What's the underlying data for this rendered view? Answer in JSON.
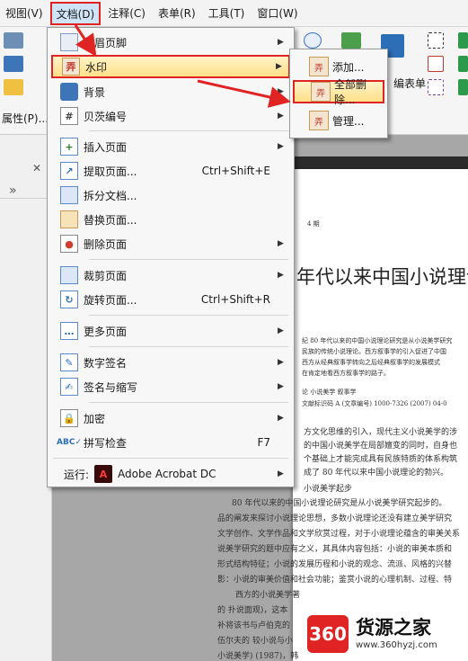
{
  "menubar": {
    "items": [
      "视图(V)",
      "文档(D)",
      "注释(C)",
      "表单(R)",
      "工具(T)",
      "窗口(W)"
    ],
    "active_index": 1
  },
  "toolbar": {
    "properties_label": "属性(P)...",
    "form_label": "编表单"
  },
  "menu": {
    "items": [
      {
        "label": "页眉页脚",
        "icon": "header-footer-icon",
        "arrow": true
      },
      {
        "label": "水印",
        "icon": "watermark-icon",
        "arrow": true,
        "highlighted": true
      },
      {
        "label": "背景",
        "icon": "background-icon",
        "arrow": true
      },
      {
        "label": "贝茨编号",
        "icon": "bates-icon",
        "arrow": true
      },
      {
        "label": "插入页面",
        "icon": "insert-page-icon",
        "arrow": true
      },
      {
        "label": "提取页面...",
        "icon": "extract-page-icon",
        "shortcut": "Ctrl+Shift+E"
      },
      {
        "label": "拆分文档...",
        "icon": "split-doc-icon"
      },
      {
        "label": "替换页面...",
        "icon": "replace-page-icon"
      },
      {
        "label": "删除页面",
        "icon": "delete-page-icon",
        "arrow": true
      },
      {
        "label": "裁剪页面",
        "icon": "crop-page-icon",
        "arrow": true
      },
      {
        "label": "旋转页面...",
        "icon": "rotate-page-icon",
        "shortcut": "Ctrl+Shift+R"
      },
      {
        "label": "更多页面",
        "icon": "more-pages-icon",
        "arrow": true
      },
      {
        "label": "数字签名",
        "icon": "digital-sign-icon",
        "arrow": true
      },
      {
        "label": "签名与缩写",
        "icon": "sign-initials-icon",
        "arrow": true
      },
      {
        "label": "加密",
        "icon": "encrypt-icon",
        "arrow": true
      },
      {
        "label": "拼写检查",
        "icon": "spell-check-icon",
        "shortcut": "F7"
      }
    ],
    "run_label": "运行:",
    "run_app": "Adobe Acrobat DC"
  },
  "submenu": {
    "items": [
      {
        "label": "添加...",
        "icon": "add-watermark-icon"
      },
      {
        "label": "全部删除...",
        "icon": "delete-all-watermark-icon",
        "highlighted": true
      },
      {
        "label": "管理...",
        "icon": "manage-watermark-icon"
      }
    ]
  },
  "document": {
    "issue": "4 期",
    "title": "年代以来中国小说理论",
    "lines": [
      "纪 80 年代以来的中国小说理论研究是从小说美学研究",
      "民族的传统小说理论。西方叙事学的引入促进了中国",
      "西方从经典叙事学转向之后经典叙事学的发展模式",
      "在肯定地看西方叙事学的路子。",
      "论      小说美学      叙事学",
      "文献标识码 A  (文章编号) 1000-7326 (2007) 04-0",
      "方文化思维的引入，现代主义小说美学的涉",
      "的中国小说美学在局部嬗变的同时，自身也",
      "个基础上才能完成具有民族特质的体系构筑",
      "成了 80 年代以来中国小说理论的勃兴。",
      "小说美学起步",
      "80 年代以来的中国小说理论研究是从小说美学研究起步的。",
      "品的阐发来探讨小说理论思想，多数小说理论还没有建立美学研究",
      "文学创作、文学作品和文学欣赏过程，对于小说理论蕴含的审美关系",
      "说美学研究的题中应有之义，其具体内容包括：小说的审美本质和",
      "形式结构特征；小说的发展历程和小说的观念、流派、风格的兴替",
      "影：小说的审美价值和社会功能；鉴赏小说的心理机制、过程、特",
      "西方的小说美学著",
      "的  扑说面观)，这本",
      "补将该书与卢伯克的",
      "伍尔夫的   较小说与小",
      "小说美学) (1987)，韩"
    ]
  },
  "watermark_logo": {
    "text": "360",
    "brand": "货源之家",
    "url": "www.360hyzj.com"
  },
  "colors": {
    "highlight": "#ffe08a",
    "red_outline": "#e02424",
    "menu_bg": "#f7f7f7",
    "logo_red": "#e02424"
  }
}
